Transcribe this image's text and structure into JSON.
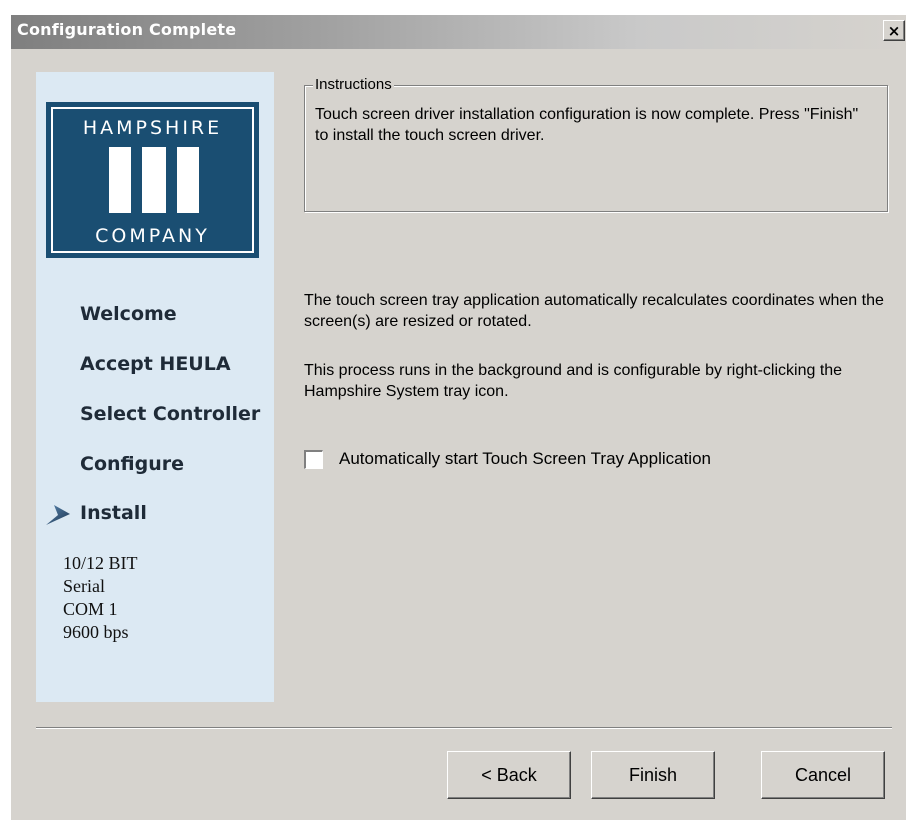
{
  "window": {
    "title": "Configuration Complete",
    "close_label": "×"
  },
  "sidebar": {
    "logo": {
      "top_text": "HAMPSHIRE",
      "bottom_text": "COMPANY"
    },
    "steps": [
      {
        "label": "Welcome",
        "current": false
      },
      {
        "label": "Accept HEULA",
        "current": false
      },
      {
        "label": "Select Controller",
        "current": false
      },
      {
        "label": "Configure",
        "current": false
      },
      {
        "label": "Install",
        "current": true
      }
    ],
    "info": [
      "10/12 BIT",
      "Serial",
      "COM 1",
      "9600 bps"
    ]
  },
  "instructions": {
    "legend": "Instructions",
    "text": "Touch screen driver installation configuration is now complete.  Press \"Finish\" to install the touch screen driver."
  },
  "main": {
    "paragraph1": "The touch screen tray application automatically recalculates coordinates when the screen(s) are resized or rotated.",
    "paragraph2": "This process runs in the background and is configurable by right-clicking the Hampshire System tray icon.",
    "checkbox": {
      "label": "Automatically start Touch Screen Tray Application",
      "checked": false
    }
  },
  "buttons": {
    "back": "< Back",
    "finish": "Finish",
    "cancel": "Cancel"
  },
  "colors": {
    "logo_blue": "#1a4e72",
    "sidebar_bg": "#dce9f3",
    "dialog_bg": "#d6d3ce"
  },
  "icons": {
    "close": "close-icon",
    "current_step": "current-step-arrow-icon"
  }
}
